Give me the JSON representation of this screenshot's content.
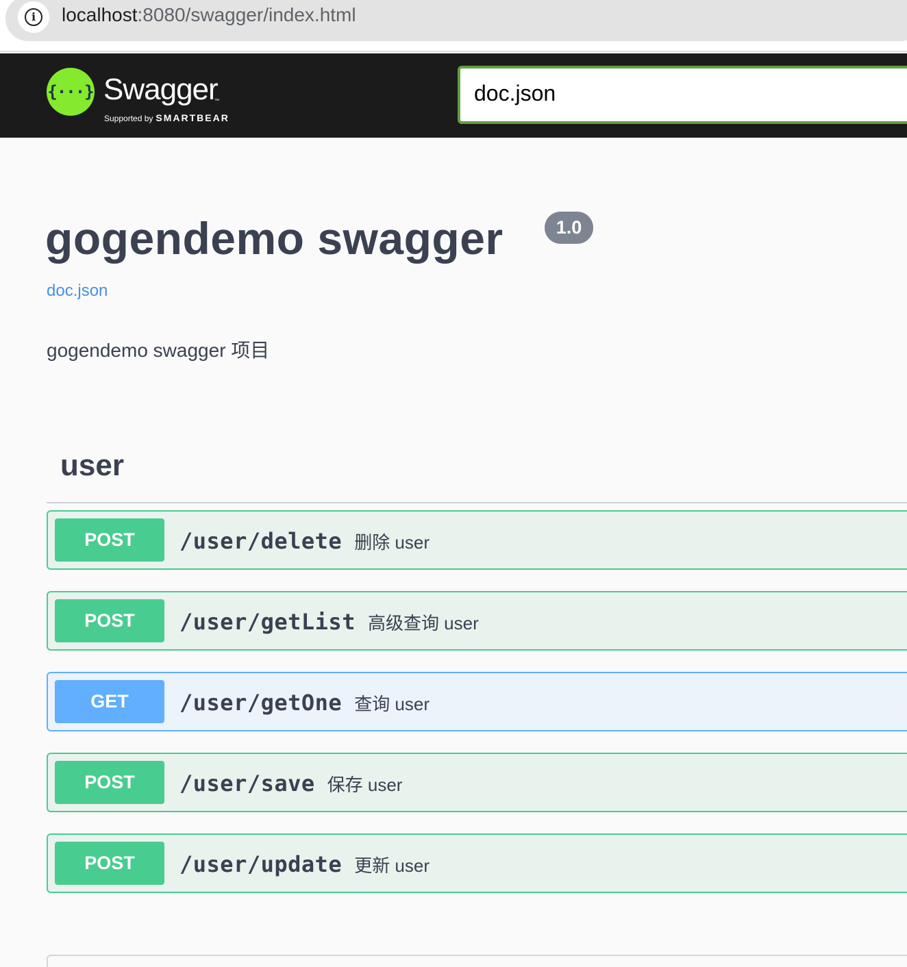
{
  "browser": {
    "url_host": "localhost",
    "url_rest": ":8080/swagger/index.html",
    "info_icon": "info-icon"
  },
  "topbar": {
    "logo_icon": "swagger-logo-icon",
    "logo_glyph": "{···}",
    "brand": "Swagger",
    "tm": "™",
    "supported_by": "Supported by",
    "smartbear": "SMARTBEAR",
    "explore_value": "doc.json"
  },
  "info": {
    "title": "gogendemo swagger",
    "version": "1.0",
    "spec_link": "doc.json",
    "description": "gogendemo swagger 项目"
  },
  "tag": {
    "name": "user",
    "operations": [
      {
        "method": "POST",
        "path": "/user/delete",
        "summary": "删除 user"
      },
      {
        "method": "POST",
        "path": "/user/getList",
        "summary": "高级查询 user"
      },
      {
        "method": "GET",
        "path": "/user/getOne",
        "summary": "查询 user"
      },
      {
        "method": "POST",
        "path": "/user/save",
        "summary": "保存 user"
      },
      {
        "method": "POST",
        "path": "/user/update",
        "summary": "更新 user"
      }
    ]
  },
  "colors": {
    "post": "#49cc90",
    "get": "#61affe",
    "topbar": "#1b1b1b",
    "logo": "#85ea2d",
    "link": "#4990e2"
  }
}
